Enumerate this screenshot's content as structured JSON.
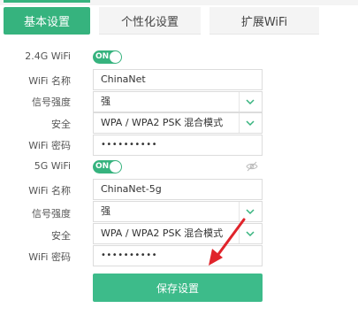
{
  "tabs": [
    {
      "label": "基本设置",
      "active": true
    },
    {
      "label": "个性化设置",
      "active": false
    },
    {
      "label": "扩展WiFi",
      "active": false
    }
  ],
  "wifi24": {
    "section_label": "2.4G WiFi",
    "toggle_text": "ON",
    "name_label": "WiFi 名称",
    "name_value": "ChinaNet",
    "signal_label": "信号强度",
    "signal_value": "强",
    "security_label": "安全",
    "security_value": "WPA / WPA2 PSK 混合模式",
    "password_label": "WiFi 密码",
    "password_value": "••••••••••"
  },
  "wifi5": {
    "section_label": "5G WiFi",
    "toggle_text": "ON",
    "name_label": "WiFi 名称",
    "name_value": "ChinaNet-5g",
    "signal_label": "信号强度",
    "signal_value": "强",
    "security_label": "安全",
    "security_value": "WPA / WPA2 PSK 混合模式",
    "password_label": "WiFi 密码",
    "password_value": "••••••••••"
  },
  "save_label": "保存设置",
  "icons": {
    "dropdown": "chevron-down-icon",
    "hide_password": "eye-slash-icon",
    "annotation": "red-arrow-icon"
  },
  "colors": {
    "accent": "#36b37e",
    "button": "#3dbb8a",
    "annotation_arrow": "#e0242b"
  }
}
